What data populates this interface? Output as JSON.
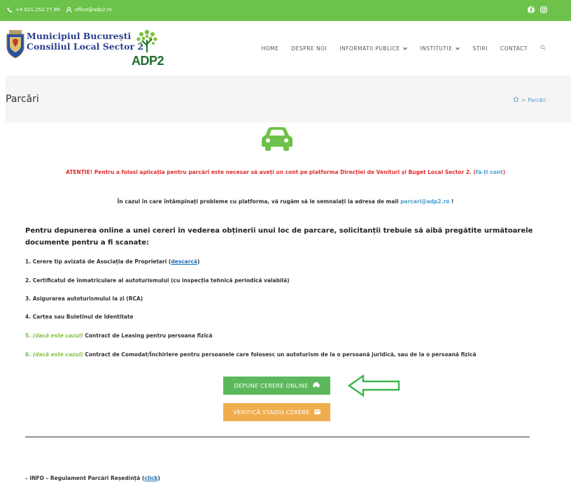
{
  "topbar": {
    "phone": "+4 021.252.77.89",
    "email": "office@adp2.ro",
    "bg_color": "#6cc24a"
  },
  "logo": {
    "line1": "Municipiul București",
    "line2": "Consiliul Local Sector 2",
    "brand": "ADP2"
  },
  "nav": {
    "items": [
      {
        "label": "HOME",
        "dropdown": false
      },
      {
        "label": "DESPRE NOI",
        "dropdown": false
      },
      {
        "label": "INFORMATII PUBLICE",
        "dropdown": true
      },
      {
        "label": "INSTITUTIE",
        "dropdown": true
      },
      {
        "label": "STIRI",
        "dropdown": false
      },
      {
        "label": "CONTACT",
        "dropdown": false
      }
    ],
    "search_icon": "search-icon"
  },
  "page": {
    "title": "Parcări",
    "breadcrumb_current": "Parcări"
  },
  "content": {
    "atentie_text": "ATENȚIE! Pentru a folosi aplicația pentru parcări este necesar să aveți un cont pe platforma Direcției de Venituri și Buget Local Sector 2. (",
    "atentie_link": "fă-ți cont",
    "atentie_end": ")",
    "probleme_text": "În cazul în care întâmpinați probleme cu platforma, vă rugăm să le semnalați la adresa de mail ",
    "probleme_email": "parcari@adp2.ro",
    "probleme_end": " !",
    "intro": "Pentru depunerea online a unei cereri în vederea obținerii unui loc de parcare, solicitanții trebuie să aibă pregătite următoarele documente pentru a fi scanate:",
    "docs": [
      {
        "num": "1.",
        "text": "Cerere tip avizată de Asociația de Proprietari (",
        "link": "descarcă",
        "end": ")"
      },
      {
        "num": "2.",
        "text": "Certificatul de înmatriculare al autoturismului (cu inspecția tehnică periodică valabilă)"
      },
      {
        "num": "3.",
        "text": "Asigurarea autoturismului la zi (RCA)"
      },
      {
        "num": "4.",
        "text": "Cartea sau Buletinul de Identitate"
      },
      {
        "num": "5.",
        "cond": "(dacă este cazul)",
        "text": "Contract de Leasing pentru persoana fizică"
      },
      {
        "num": "6.",
        "cond": "(dacă este cazul)",
        "text": "Contract de Comodat/Închiriere  pentru persoanele care folosesc un autoturism de la o persoană juridică, sau de la o persoană fizică"
      }
    ],
    "btn_depune": "DEPUNE CERERE ONLINE",
    "btn_verifica": "VERIFICĂ STADIU CERERE",
    "info_text": "– INFO – Regulament Parcări Reședință (",
    "info_link": "click",
    "info_end": ")"
  },
  "colors": {
    "green": "#6cc24a",
    "red": "#e12e2e",
    "link": "#4a9fcf",
    "btn_green": "#5cb85c",
    "btn_orange": "#f0ad4e"
  }
}
